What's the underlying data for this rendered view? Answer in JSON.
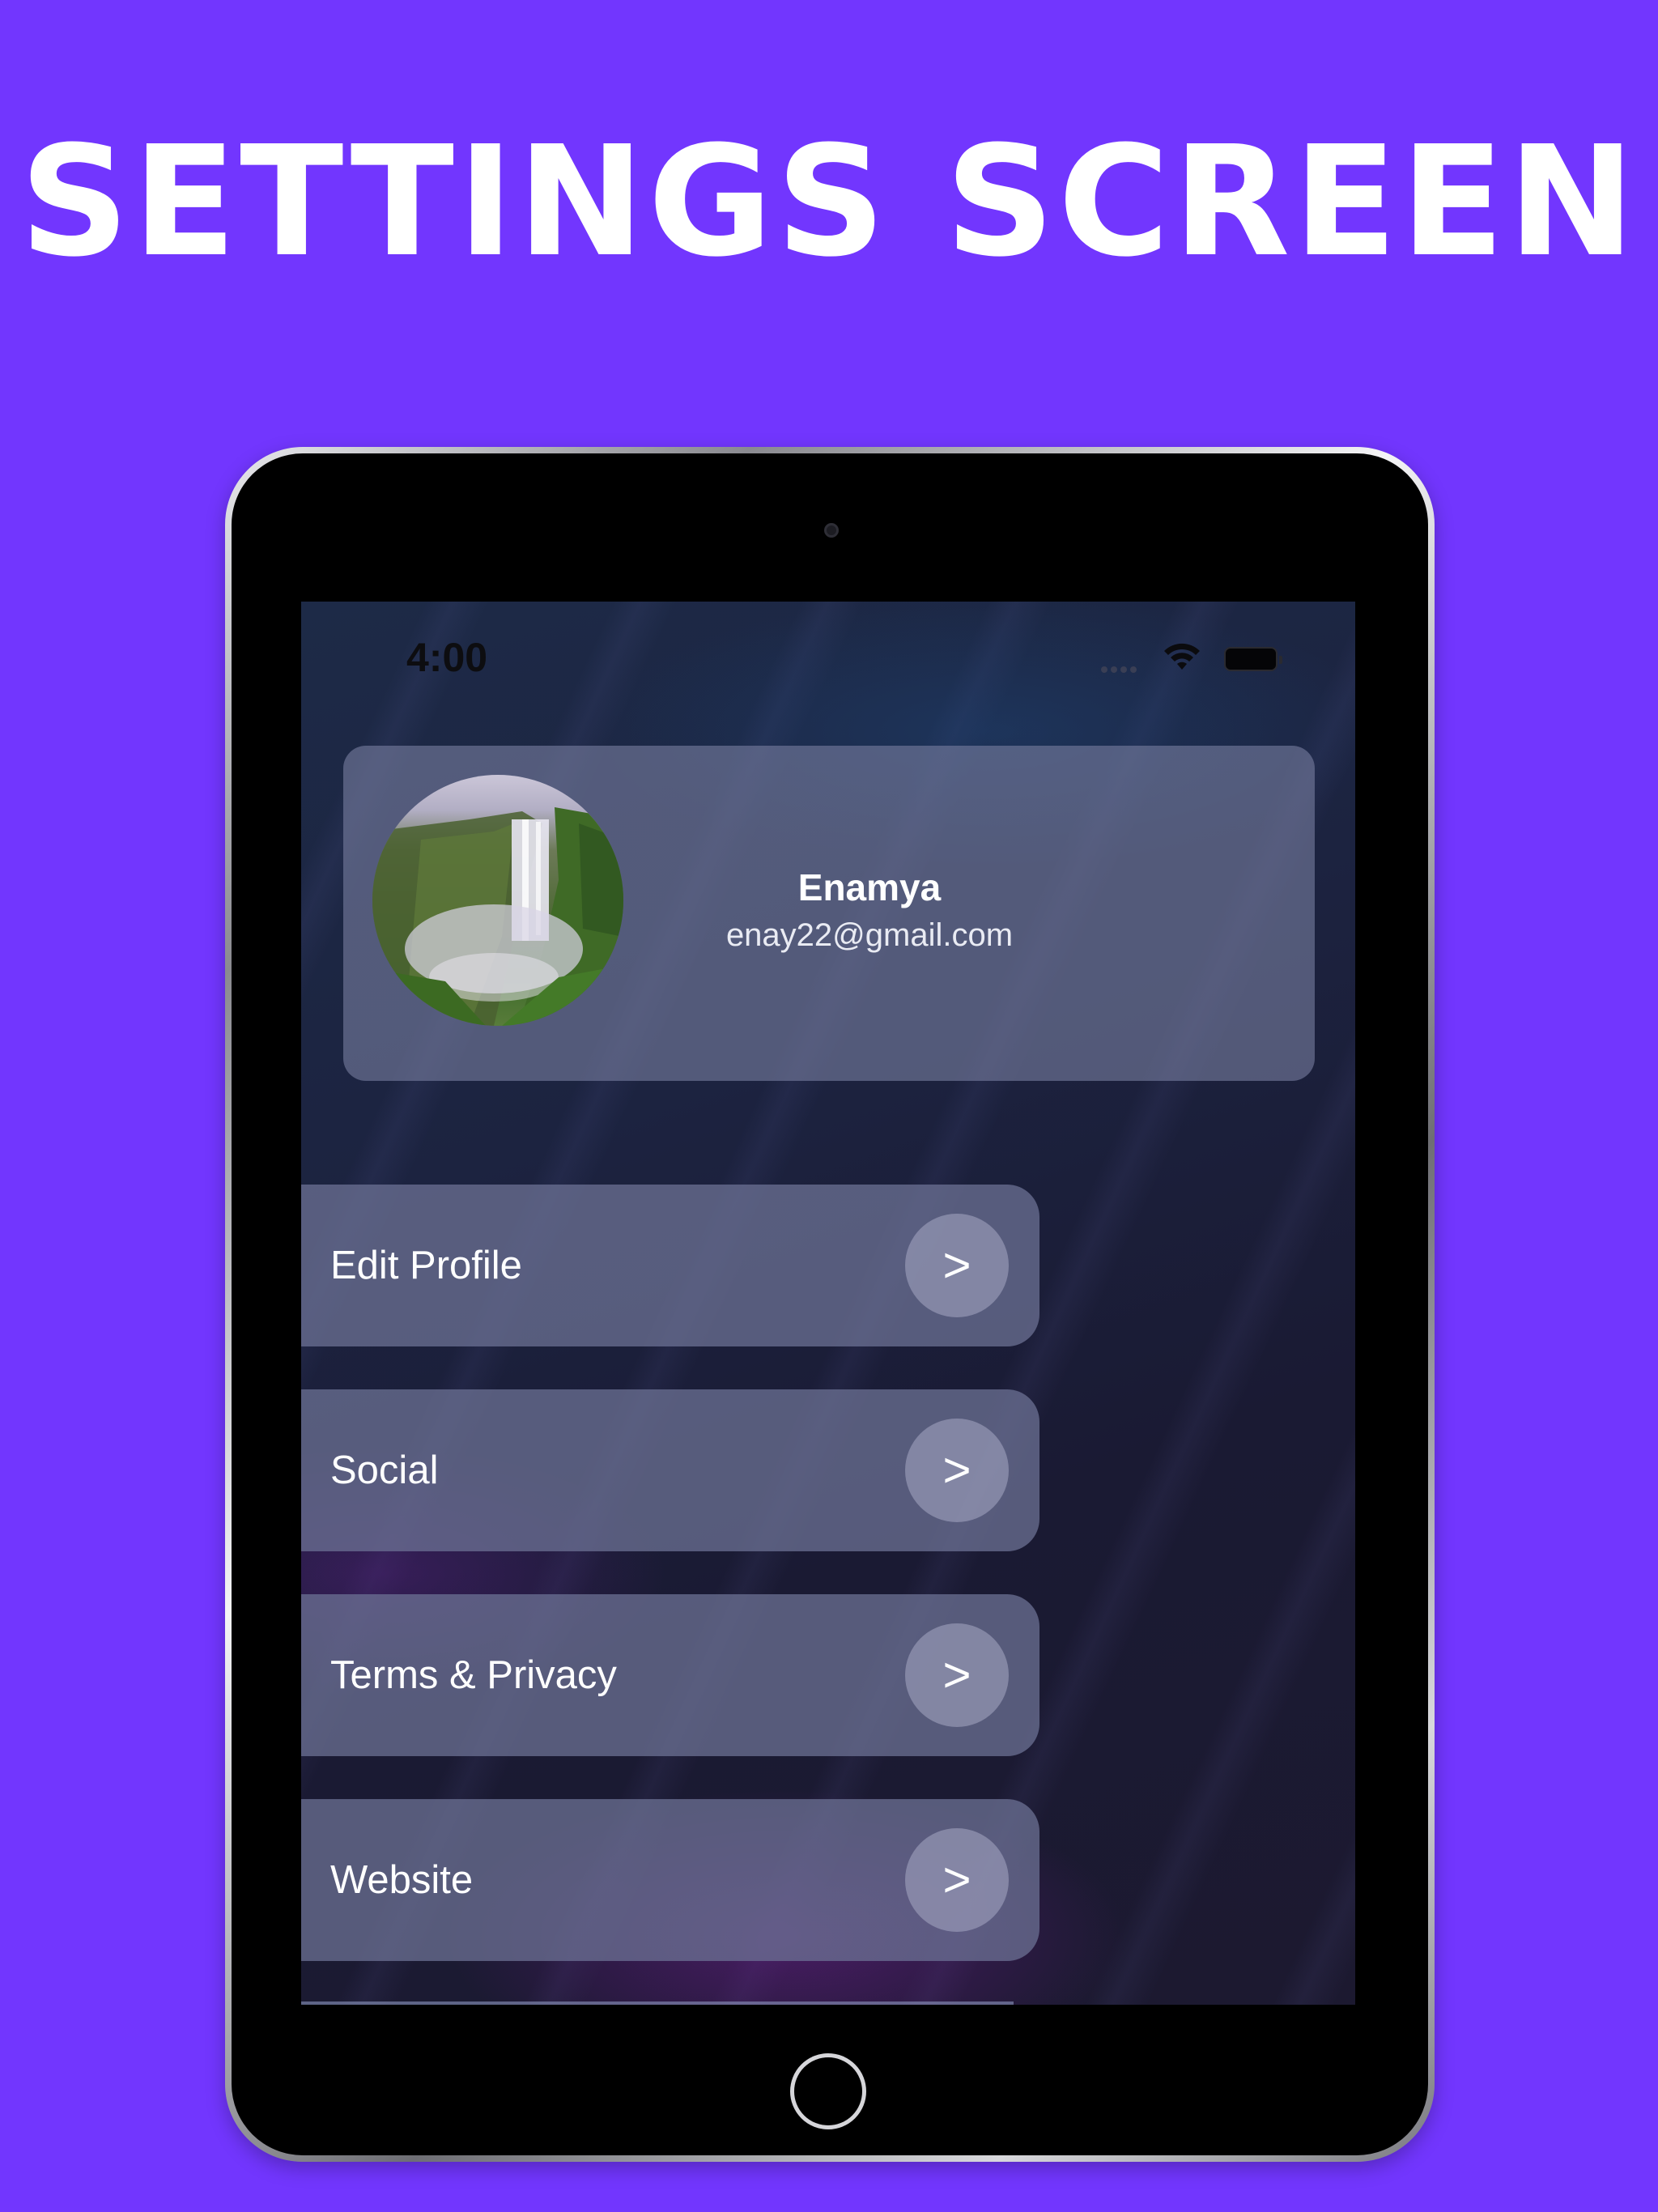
{
  "headline": "SETTINGS SCREEN",
  "status_bar": {
    "time": "4:00"
  },
  "profile": {
    "name": "Enamya",
    "email": "enay22@gmail.com"
  },
  "menu": [
    {
      "label": "Edit Profile",
      "arrow": ">"
    },
    {
      "label": "Social",
      "arrow": ">"
    },
    {
      "label": "Terms & Privacy",
      "arrow": ">"
    },
    {
      "label": "Website",
      "arrow": ">"
    }
  ],
  "colors": {
    "background": "#7236fe",
    "card": "#6c7294",
    "text": "#ffffff"
  },
  "icons": [
    "wifi-icon",
    "battery-icon",
    "signal-icon",
    "chevron-right-icon"
  ]
}
